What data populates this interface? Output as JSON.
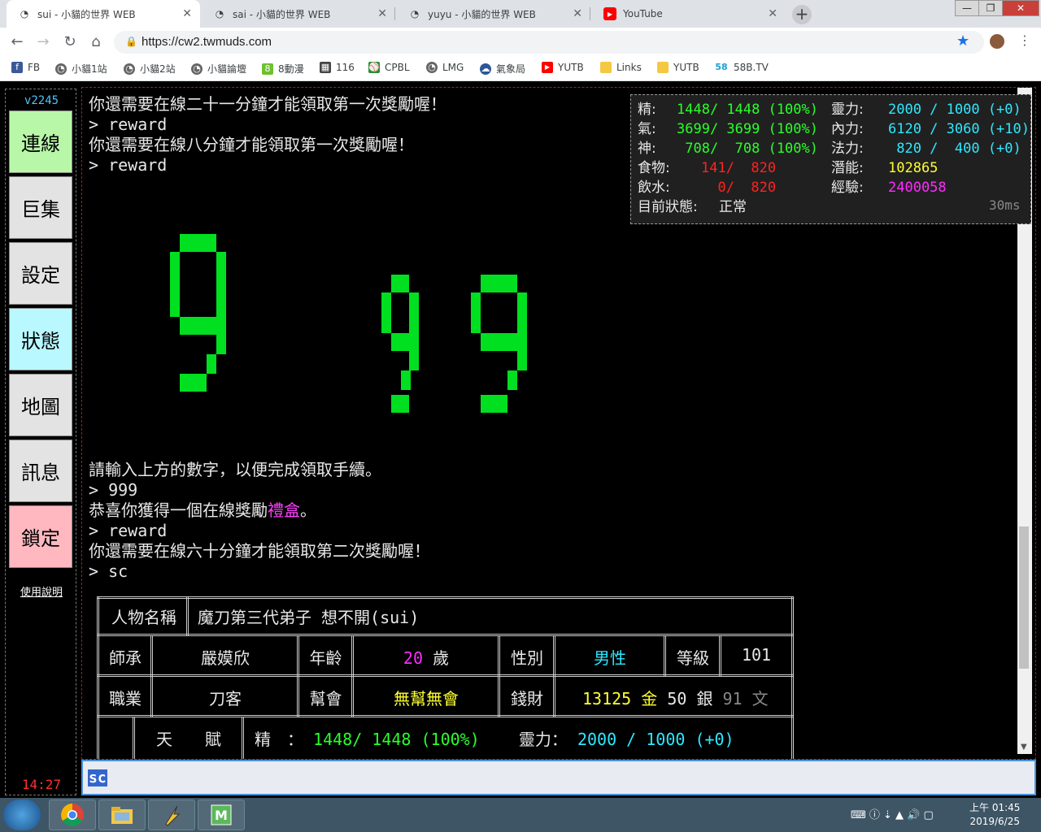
{
  "tabs": [
    {
      "title": "sui - 小貓的世界 WEB",
      "icon": "site-icon",
      "active": true
    },
    {
      "title": "sai - 小貓的世界 WEB",
      "icon": "site-icon",
      "active": false
    },
    {
      "title": "yuyu - 小貓的世界 WEB",
      "icon": "site-icon",
      "active": false
    },
    {
      "title": "YouTube",
      "icon": "youtube-icon",
      "active": false
    }
  ],
  "url": "https://cw2.twmuds.com",
  "bookmarks": [
    "FB",
    "小貓1站",
    "小貓2站",
    "小貓論壇",
    "8動漫",
    "116",
    "CPBL",
    "LMG",
    "氣象局",
    "YUTB",
    "Links",
    "YUTB",
    "58B.TV"
  ],
  "sidebar": {
    "version": "v2245",
    "buttons": [
      {
        "label": "連線",
        "color": "#b8f7a8"
      },
      {
        "label": "巨集",
        "color": "#e3e3e3"
      },
      {
        "label": "設定",
        "color": "#e3e3e3"
      },
      {
        "label": "狀態",
        "color": "#b9f8ff"
      },
      {
        "label": "地圖",
        "color": "#e3e3e3"
      },
      {
        "label": "訊息",
        "color": "#e3e3e3"
      },
      {
        "label": "鎖定",
        "color": "#ffb8c0"
      }
    ],
    "help": "使用說明",
    "clock": "14:27"
  },
  "terminal": {
    "lines_top": [
      "你還需要在線二十一分鐘才能領取第一次獎勵喔！",
      "> reward",
      "你還需要在線八分鐘才能領取第一次獎勵喔！",
      "> reward"
    ],
    "captcha": [
      {
        "digit": "9",
        "color": "#00e020"
      },
      {
        "digit": "9",
        "color": "#00e020"
      },
      {
        "digit": "9",
        "color": "#00e020"
      }
    ],
    "prompt_line": "請輸入上方的數字，以便完成領取手續。",
    "answer": "> 999",
    "congrats_pre": "恭喜你獲得一個在線獎勵",
    "congrats_item": "禮盒",
    "congrats_post": "。",
    "reward2": "> reward",
    "line_second": "你還需要在線六十分鐘才能領取第二次獎勵喔！",
    "sc_cmd": "> sc"
  },
  "status_panel": {
    "jing_label": "精:",
    "jing_value": "1448/ 1448 (100%)",
    "qi_label": "氣:",
    "qi_value": "3699/ 3699 (100%)",
    "shen_label": "神:",
    "shen_value": " 708/  708 (100%)",
    "food_label": "食物:",
    "food_value": "141/  820",
    "water_label": "飲水:",
    "water_value": "  0/  820",
    "state_label": "目前狀態:",
    "state_value": "正常",
    "lingli_label": "靈力:",
    "lingli_value": "2000 / 1000 (+0)",
    "neili_label": "內力:",
    "neili_value": "6120 / 3060 (+10)",
    "fali_label": "法力:",
    "fali_value": " 820 /  400 (+0)",
    "qianneng_label": "潛能:",
    "qianneng_value": "102865",
    "exp_label": "經驗:",
    "exp_value": "2400058",
    "latency": "30ms"
  },
  "sc_table": {
    "name_label": "人物名稱",
    "name_value": "魔刀第三代弟子 想不開(sui)",
    "master_label": "師承",
    "master_value": "嚴嫫欣",
    "age_label": "年齡",
    "age_value": "20",
    "age_unit": "歲",
    "gender_label": "性別",
    "gender_value": "男性",
    "level_label": "等級",
    "level_value": "101",
    "job_label": "職業",
    "job_value": "刀客",
    "guild_label": "幫會",
    "guild_value": "無幫無會",
    "money_label": "錢財",
    "money_gold": "13125",
    "money_gold_unit": "金",
    "money_silver": "50",
    "money_silver_unit": "銀",
    "money_copper": "91",
    "money_copper_unit": "文",
    "talent_label": "天　　賦",
    "talent_jing_label": "精　：",
    "talent_jing_value": "1448/ 1448 (100%)",
    "talent_ling_label": "靈力：",
    "talent_ling_value": "2000 / 1000 (+0)"
  },
  "input_value": "sc",
  "taskbar": {
    "time": "上午 01:45",
    "date": "2019/6/25",
    "apps": [
      "chrome-icon",
      "folder-icon",
      "app-icon",
      "m-app-icon"
    ]
  }
}
